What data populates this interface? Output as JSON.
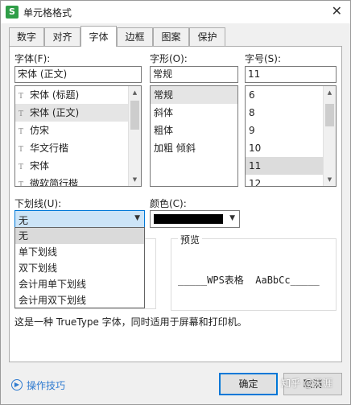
{
  "window": {
    "title": "单元格格式",
    "app_icon": "S",
    "close": "✕"
  },
  "tabs": [
    {
      "label": "数字",
      "active": false
    },
    {
      "label": "对齐",
      "active": false
    },
    {
      "label": "字体",
      "active": true
    },
    {
      "label": "边框",
      "active": false
    },
    {
      "label": "图案",
      "active": false
    },
    {
      "label": "保护",
      "active": false
    }
  ],
  "font": {
    "label": "字体(F):",
    "value": "宋体 (正文)",
    "items": [
      "宋体 (标题)",
      "宋体 (正文)",
      "仿宋",
      "华文行楷",
      "宋体",
      "微软简行楷"
    ],
    "selected_index": 1,
    "item_icon": "T"
  },
  "style": {
    "label": "字形(O):",
    "value": "常规",
    "items": [
      "常规",
      "斜体",
      "粗体",
      "加粗 倾斜"
    ],
    "selected_index": 0
  },
  "size": {
    "label": "字号(S):",
    "value": "11",
    "items": [
      "6",
      "8",
      "9",
      "10",
      "11",
      "12"
    ],
    "selected_index": 4
  },
  "underline": {
    "label": "下划线(U):",
    "value": "无",
    "options": [
      "无",
      "单下划线",
      "双下划线",
      "会计用单下划线",
      "会计用双下划线"
    ],
    "highlighted_index": 0
  },
  "color": {
    "label": "颜色(C):",
    "swatch": "#000000"
  },
  "preview": {
    "label": "预览",
    "text": "_____WPS表格  AaBbCc_____"
  },
  "note": "这是一种 TrueType 字体，同时适用于屏幕和打印机。",
  "help": {
    "label": "操作技巧"
  },
  "buttons": {
    "ok": "确定",
    "cancel": "取消"
  },
  "watermark": "知乎 @天涯"
}
